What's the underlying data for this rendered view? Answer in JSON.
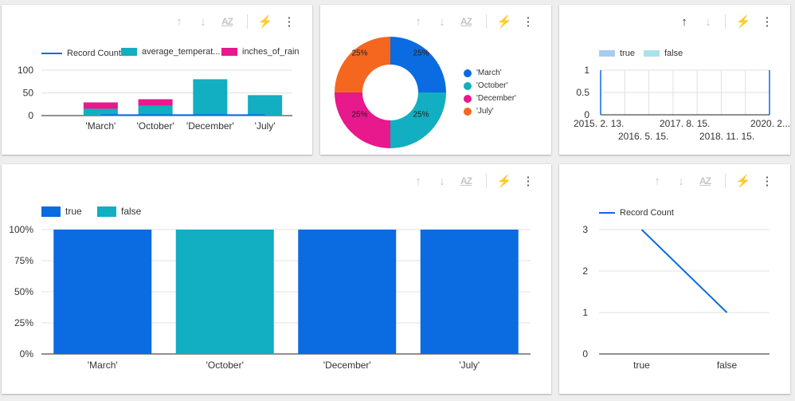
{
  "colors": {
    "blue": "#0b6be0",
    "teal": "#12aec1",
    "pink": "#e8188d",
    "orange": "#f5661f",
    "grid": "#e0e0e0",
    "axis": "#222222"
  },
  "toolbar_icons": [
    "arrow-up-icon",
    "arrow-down-icon",
    "sort-az-icon",
    "lightning-icon",
    "more-vert-icon"
  ],
  "chart_data": [
    {
      "type": "bar",
      "stacked": true,
      "categories": [
        "'March'",
        "'October'",
        "'December'",
        "'July'"
      ],
      "series": [
        {
          "name": "Record Count",
          "kind": "line",
          "values": [
            1,
            1,
            1,
            1
          ],
          "color": "#0b6be0"
        },
        {
          "name": "average_temperat...",
          "values": [
            15,
            22,
            80,
            45
          ],
          "color": "#12aec1"
        },
        {
          "name": "inches_of_rain",
          "values": [
            14,
            14,
            0,
            0
          ],
          "color": "#e8188d"
        }
      ],
      "yticks": [
        "0",
        "50",
        "100"
      ],
      "ylim": [
        0,
        100
      ],
      "legend": "top"
    },
    {
      "type": "pie",
      "donut": true,
      "slices": [
        {
          "label": "'March'",
          "value": 25,
          "text": "25%",
          "color": "#0b6be0"
        },
        {
          "label": "'October'",
          "value": 25,
          "text": "25%",
          "color": "#12aec1"
        },
        {
          "label": "'December'",
          "value": 25,
          "text": "25%",
          "color": "#e8188d"
        },
        {
          "label": "'July'",
          "value": 25,
          "text": "25%",
          "color": "#f5661f"
        }
      ],
      "legend": "right"
    },
    {
      "type": "area",
      "series": [
        {
          "name": "true",
          "color": "#0b6be0"
        },
        {
          "name": "false",
          "color": "#12aec1"
        }
      ],
      "x_ticks_row1": [
        "2015. 2. 13.",
        "2017. 8. 15.",
        "2020. 2...."
      ],
      "x_ticks_row2": [
        "2016. 5. 15.",
        "2018. 11. 15."
      ],
      "yticks": [
        "0",
        "0.5",
        "1"
      ],
      "ylim": [
        0,
        1
      ],
      "legend": "top"
    },
    {
      "type": "bar",
      "stacked": true,
      "percent": true,
      "categories": [
        "'March'",
        "'October'",
        "'December'",
        "'July'"
      ],
      "series": [
        {
          "name": "true",
          "values": [
            100,
            0,
            100,
            100
          ],
          "color": "#0b6be0"
        },
        {
          "name": "false",
          "values": [
            0,
            100,
            0,
            0
          ],
          "color": "#12aec1"
        }
      ],
      "yticks": [
        "0%",
        "25%",
        "50%",
        "75%",
        "100%"
      ],
      "ylim": [
        0,
        100
      ],
      "legend": "top-left"
    },
    {
      "type": "line",
      "x": [
        "true",
        "false"
      ],
      "series": [
        {
          "name": "Record Count",
          "values": [
            3,
            1
          ],
          "color": "#0b6be0"
        }
      ],
      "yticks": [
        "0",
        "1",
        "2",
        "3"
      ],
      "ylim": [
        0,
        3
      ],
      "legend": "top"
    }
  ]
}
